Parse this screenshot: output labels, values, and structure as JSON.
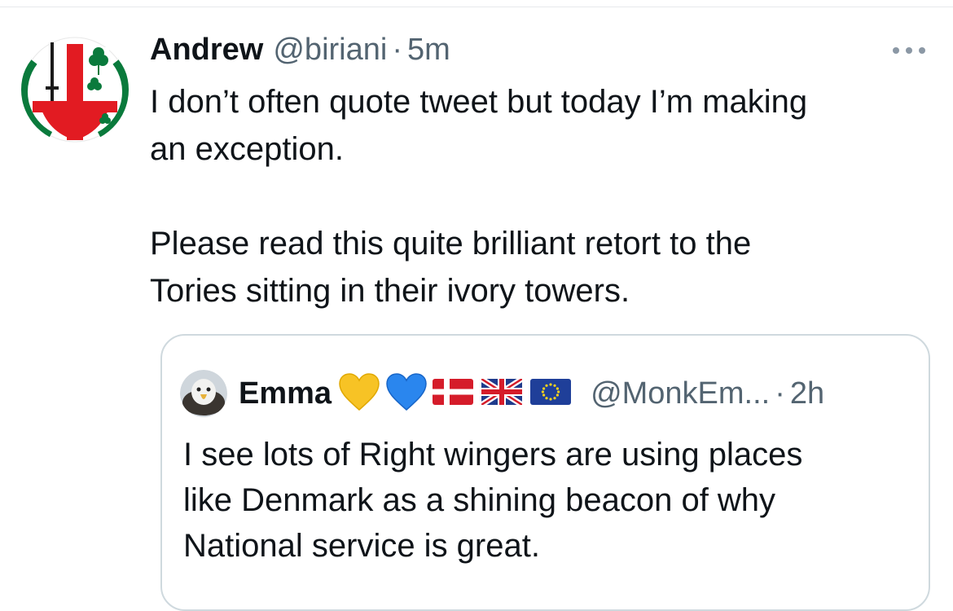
{
  "tweet": {
    "author_name": "Andrew",
    "author_handle": "@biriani",
    "separator": "·",
    "time": "5m",
    "avatar_icon": "london-irish-crest-icon",
    "more_icon": "more-dots-icon",
    "text": "I don’t often quote tweet but today I’m making\nan exception.\n\nPlease read this quite brilliant retort to the\nTories sitting in their ivory towers."
  },
  "quoted_tweet": {
    "author_name": "Emma",
    "author_handle": "@MonkEm...",
    "separator": "·",
    "time": "2h",
    "avatar_icon": "eagle-avatar-icon",
    "name_emojis": [
      "yellow-heart-icon",
      "blue-heart-icon",
      "denmark-flag-icon",
      "uk-flag-icon",
      "eu-flag-icon"
    ],
    "text": "I see lots of Right wingers are using places\nlike Denmark as a shining beacon of why\nNational service is great."
  },
  "colors": {
    "text_primary": "#0f1419",
    "text_secondary": "#536471",
    "border": "#cfd9de",
    "crest_green": "#0a7a3c",
    "crest_red": "#e21b22"
  }
}
